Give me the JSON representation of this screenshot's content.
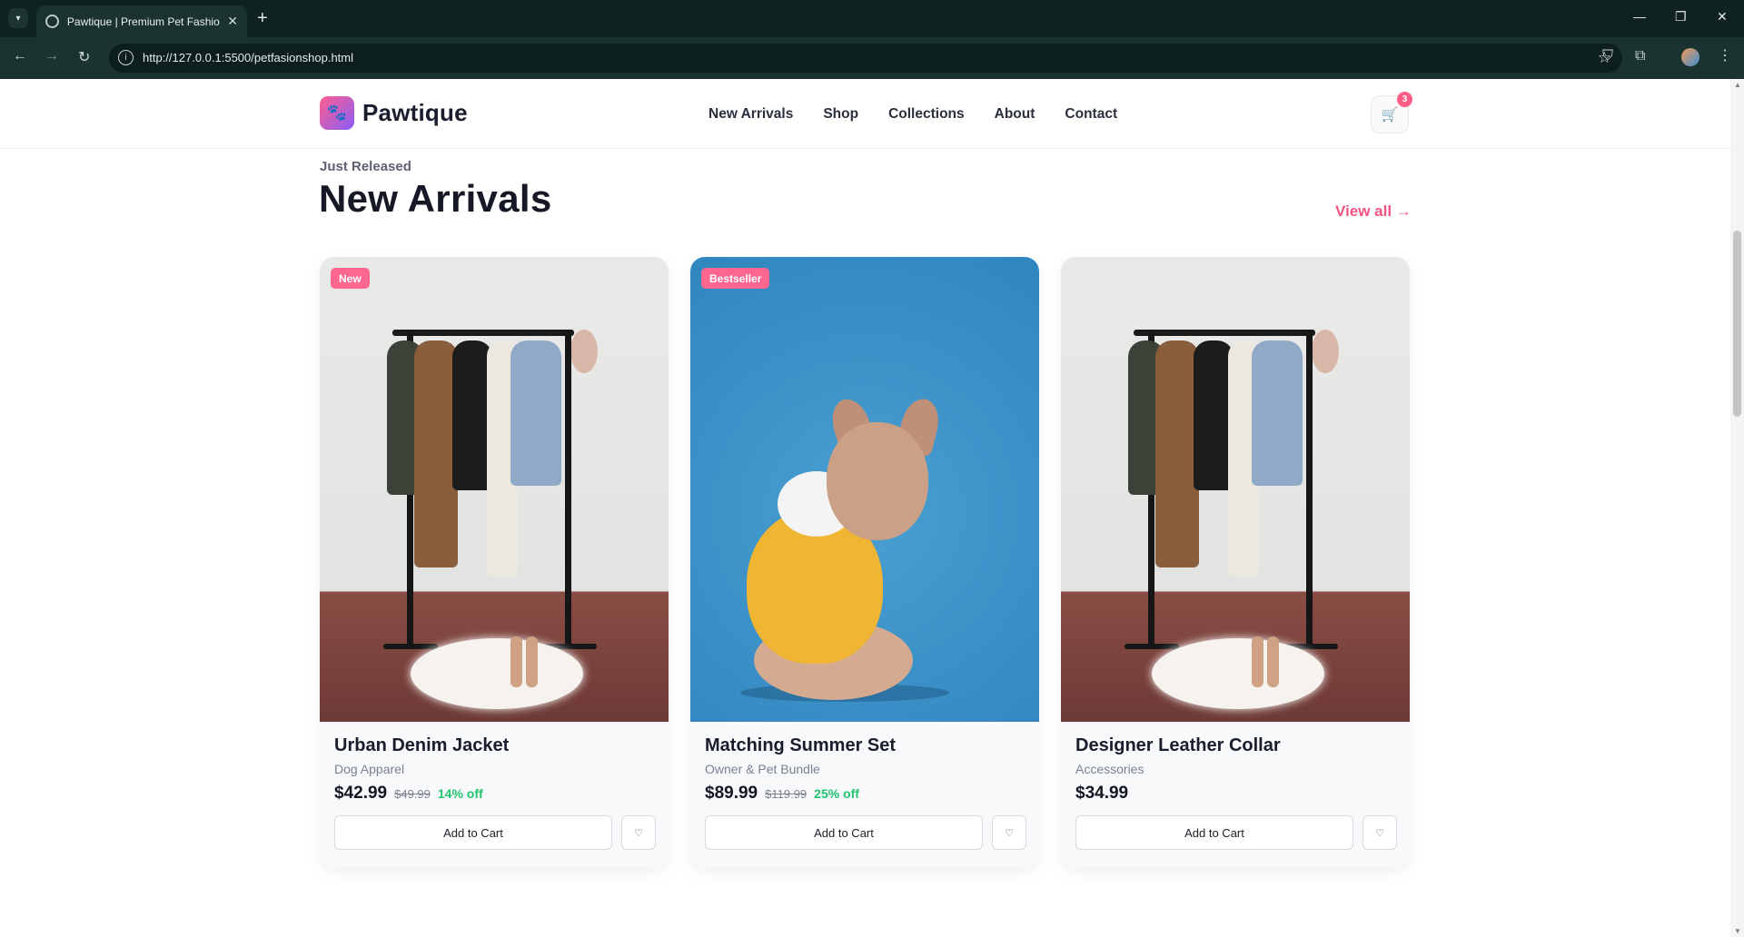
{
  "browser": {
    "tab_title": "Pawtique | Premium Pet Fashion",
    "url": "http://127.0.0.1:5500/petfasionshop.html",
    "new_tab_glyph": "+",
    "tab_close_glyph": "✕",
    "window_controls": {
      "minimize": "—",
      "restore": "❐",
      "close": "✕"
    }
  },
  "site": {
    "brand": "Pawtique",
    "logo_icon": "🐾",
    "nav": [
      "New Arrivals",
      "Shop",
      "Collections",
      "About",
      "Contact"
    ],
    "cart_icon": "🛒",
    "cart_count": "3"
  },
  "section": {
    "eyebrow": "Just Released",
    "title": "New Arrivals",
    "view_all": "View all →"
  },
  "products": [
    {
      "badge": "New",
      "name": "Urban Denim Jacket",
      "category": "Dog Apparel",
      "price": "$42.99",
      "old_price": "$49.99",
      "discount": "14% off",
      "add_label": "Add to Cart",
      "wish_icon": "♡",
      "image": "clothing-rack-photo"
    },
    {
      "badge": "Bestseller",
      "name": "Matching Summer Set",
      "category": "Owner & Pet Bundle",
      "price": "$89.99",
      "old_price": "$119.99",
      "discount": "25% off",
      "add_label": "Add to Cart",
      "wish_icon": "♡",
      "image": "french-bulldog-yellow-hoodie-photo"
    },
    {
      "badge": "",
      "name": "Designer Leather Collar",
      "category": "Accessories",
      "price": "$34.99",
      "old_price": "",
      "discount": "",
      "add_label": "Add to Cart",
      "wish_icon": "♡",
      "image": "clothing-rack-photo"
    }
  ],
  "colors": {
    "accent": "#f0567f",
    "badge": "#ff6791",
    "discount": "#22c46e",
    "chrome_dark": "#0f2220"
  }
}
